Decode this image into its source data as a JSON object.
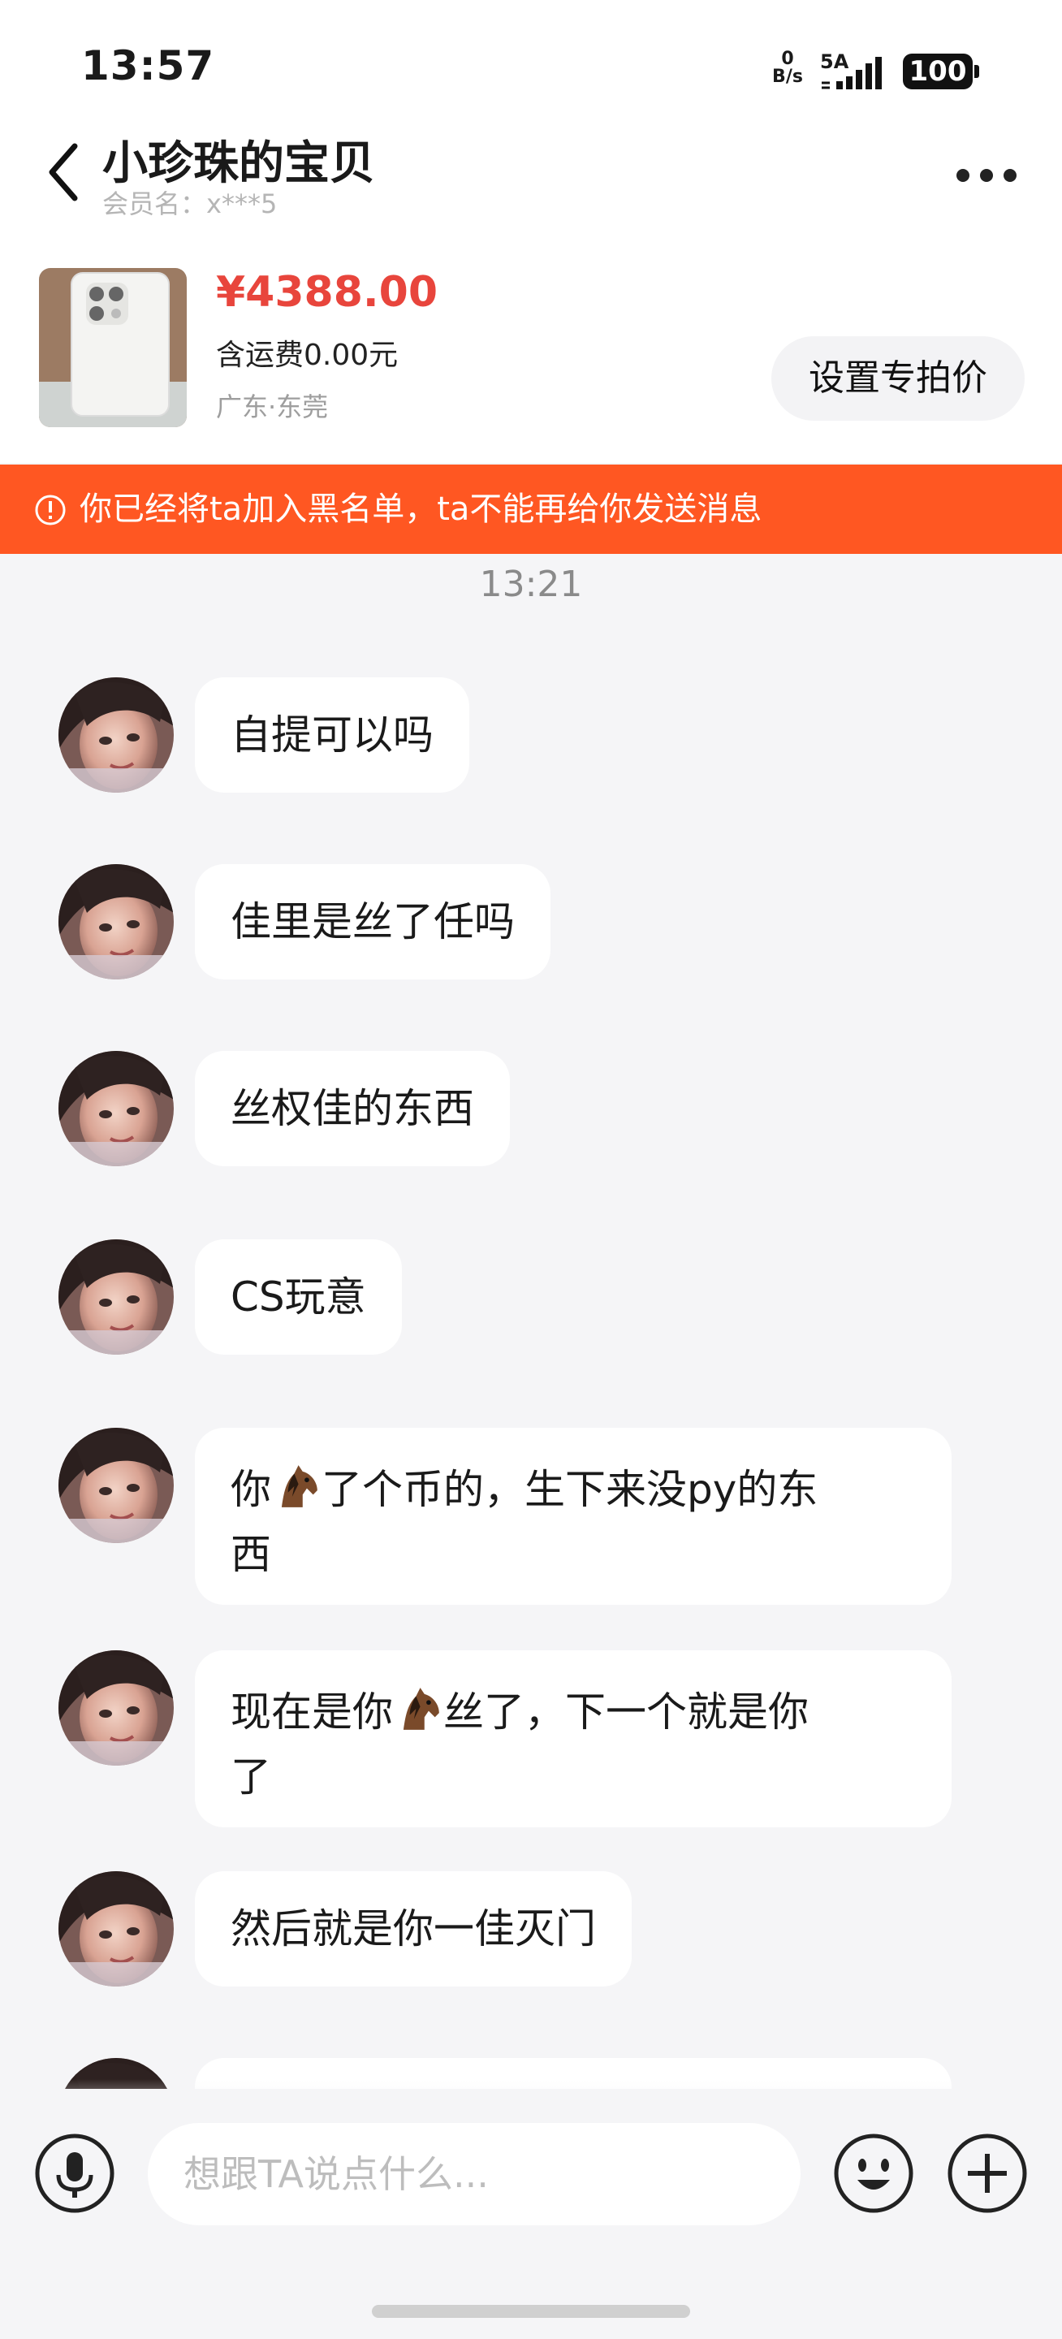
{
  "status_bar": {
    "time": "13:57",
    "net_speed_value": "0",
    "net_speed_unit": "B/s",
    "signal_label": "5A",
    "battery": "100"
  },
  "header": {
    "title": "小珍珠的宝贝",
    "member_label": "会员名：",
    "member_name": "x***5"
  },
  "product": {
    "price": "¥4388.00",
    "shipping": "含运费0.00元",
    "location": "广东·东莞",
    "special_price_button": "设置专拍价"
  },
  "banner": {
    "text": "你已经将ta加入黑名单，ta不能再给你发送消息",
    "color": "#ff5722"
  },
  "chat": {
    "timestamp": "13:21",
    "messages": [
      {
        "text": "自提可以吗"
      },
      {
        "text": "佳里是丝了任吗"
      },
      {
        "text": "丝权佳的东西"
      },
      {
        "text": "CS玩意"
      },
      {
        "text_before": "你",
        "emoji": "horse-icon",
        "text_after": "了个币的，生下来没py的东",
        "text_line2": "西"
      },
      {
        "text_before": "现在是你",
        "emoji": "horse-icon",
        "text_after": "丝了，下一个就是你",
        "text_line2": "了"
      },
      {
        "text": "然后就是你一佳灭门"
      }
    ]
  },
  "input_bar": {
    "placeholder": "想跟TA说点什么..."
  },
  "colors": {
    "price": "#e8453c",
    "banner": "#ff5722",
    "bubble": "#ffffff",
    "background": "#f5f5f7"
  }
}
